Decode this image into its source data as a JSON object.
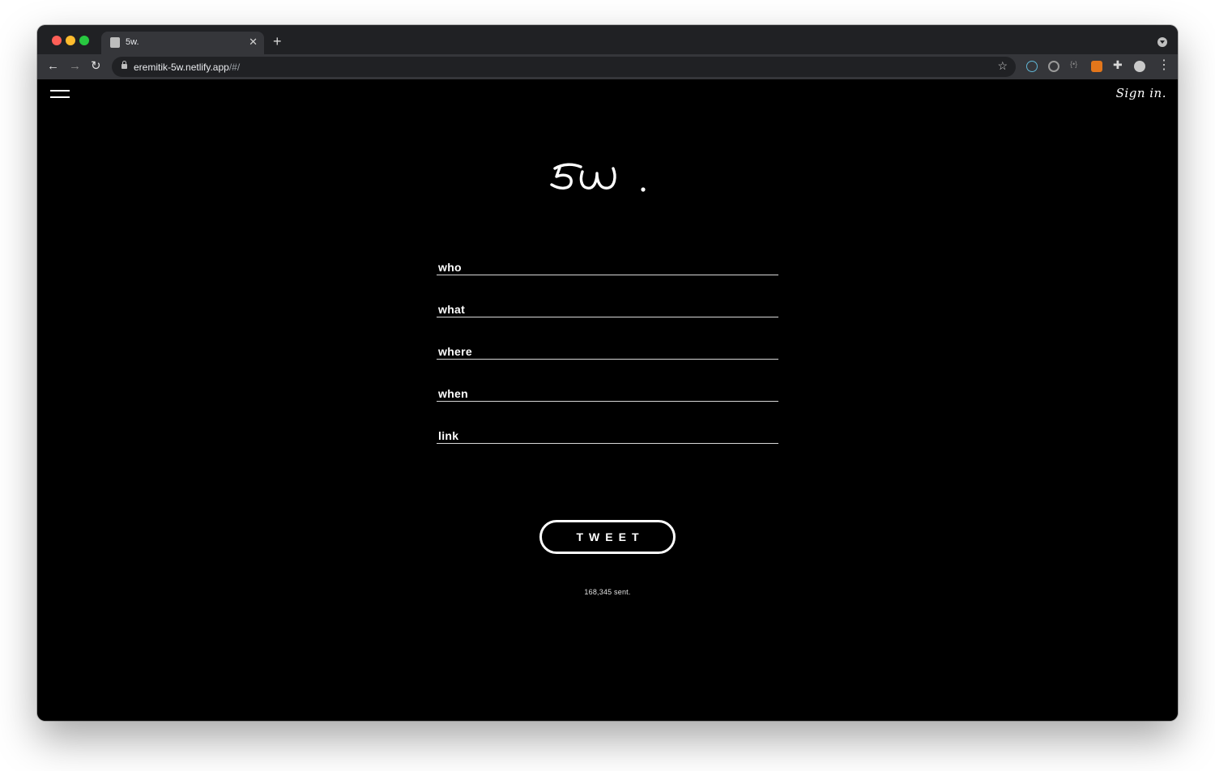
{
  "browser": {
    "tab_title": "5w.",
    "tab_close": "✕",
    "new_tab": "+",
    "url_host": "eremitik-5w.netlify.app",
    "url_path": "/#/",
    "nav_back": "←",
    "nav_forward": "→",
    "nav_reload": "↻",
    "bookmark_star": "☆",
    "menu": "⋮",
    "extensions": [
      "react-devtools-icon",
      "circle-extension-icon",
      "code-extension-icon",
      "metamask-fox-icon",
      "puzzle-extensions-icon",
      "profile-avatar-icon"
    ]
  },
  "header": {
    "signin_label": "Sign in."
  },
  "logo": {
    "text": "5w."
  },
  "form": {
    "fields": [
      {
        "label": "who"
      },
      {
        "label": "what"
      },
      {
        "label": "where"
      },
      {
        "label": "when"
      },
      {
        "label": "link"
      }
    ]
  },
  "actions": {
    "tweet_label": "TWEET"
  },
  "stats": {
    "sent_text": "168,345 sent."
  },
  "colors": {
    "page_bg": "#000000",
    "text": "#ffffff",
    "chrome_dark": "#202124",
    "chrome_tab": "#35363a"
  }
}
